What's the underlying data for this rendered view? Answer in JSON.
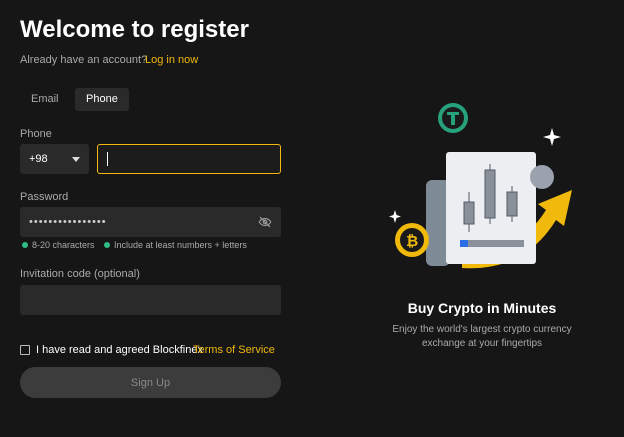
{
  "title": "Welcome to register",
  "account_prompt": "Already have an account?",
  "login_link": "Log in now",
  "tabs": [
    {
      "label": "Email",
      "active": false
    },
    {
      "label": "Phone",
      "active": true
    }
  ],
  "phone": {
    "label": "Phone",
    "country_code": "+98",
    "value": ""
  },
  "password": {
    "label": "Password",
    "masked_value": "••••••••••••••••",
    "rules": [
      "8-20 characters",
      "Include at least numbers + letters"
    ]
  },
  "invitation": {
    "label": "Invitation code (optional)",
    "value": ""
  },
  "agreement": {
    "text": "I have read and agreed Blockfinex",
    "link": "Terms of Service",
    "checked": false
  },
  "signup_label": "Sign Up",
  "promo": {
    "title": "Buy Crypto in Minutes",
    "subtitle": "Enjoy the world's largest crypto currency exchange at your fingertips"
  },
  "colors": {
    "accent": "#f0b90b",
    "success": "#2ebd85",
    "tether": "#26a17b",
    "background": "#161616"
  },
  "icons": [
    "chevron-down-icon",
    "eye-off-icon",
    "tether-icon",
    "bitcoin-icon",
    "sparkle-icon",
    "arrow-up-icon"
  ]
}
